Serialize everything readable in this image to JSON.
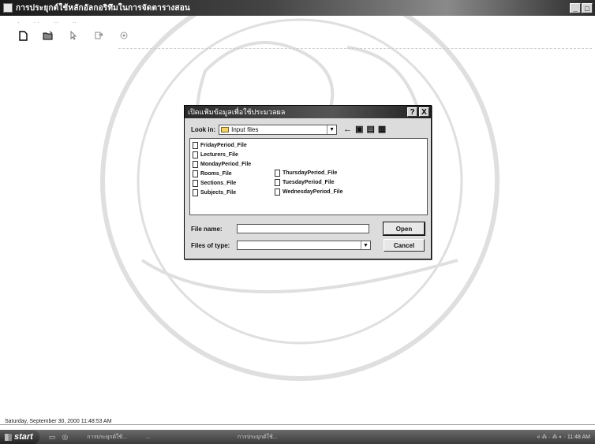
{
  "window": {
    "title": "การประยุกต์ใช้หลักอัลกอริทึมในการจัดตารางสอน",
    "controls": [
      "_",
      "□"
    ]
  },
  "menu": {
    "items": [
      "·",
      "· ·",
      "··",
      "··"
    ]
  },
  "toolbar": {
    "icons": [
      "new-file-icon",
      "open-folder-icon",
      "cursor-icon",
      "export-icon",
      "settings-icon"
    ]
  },
  "dialog": {
    "title": "เปิดแฟ้มข้อมูลเพื่อใช้ประมวลผล",
    "help_label": "?",
    "close_label": "X",
    "look_in_label": "Look in:",
    "look_in_value": "Input files",
    "files": [
      "FridayPeriod_File",
      "Lecturers_File",
      "MondayPeriod_File",
      "Rooms_File",
      "Sections_File",
      "Subjects_File",
      "ThursdayPeriod_File",
      "TuesdayPeriod_File",
      "WednesdayPeriod_File"
    ],
    "file_name_label": "File name:",
    "file_name_value": "",
    "files_of_type_label": "Files of type:",
    "files_of_type_value": "",
    "open_label": "Open",
    "cancel_label": "Cancel"
  },
  "status": {
    "text": "Saturday, September 30, 2000 11:48:53 AM"
  },
  "taskbar": {
    "start_label": "start",
    "tasks": [
      "การประยุกต์ใช้...",
      "...",
      "การประยุกต์ใช้..."
    ],
    "tray": "« ⁂ · ⁂ ◐ · 11:48 AM"
  },
  "colors": {
    "titlebar": "#2a2a2a",
    "dialog_bg": "#dcdcdc",
    "taskbar": "#3b3b3b"
  }
}
